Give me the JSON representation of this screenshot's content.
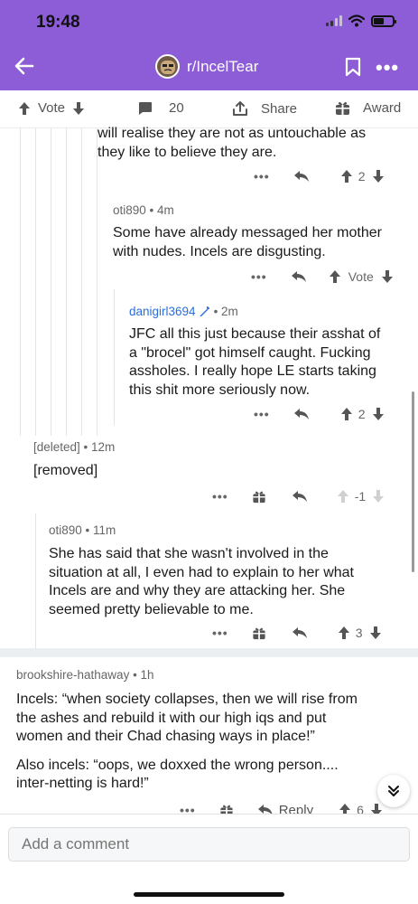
{
  "status_bar": {
    "time": "19:48"
  },
  "header": {
    "subreddit": "r/IncelTear"
  },
  "action_bar": {
    "vote": "Vote",
    "comments": "20",
    "share": "Share",
    "award": "Award"
  },
  "comments": [
    {
      "id": "c1",
      "author": "",
      "body_lines": [
        "will realise they are not as untouchable as",
        "they like to believe they are."
      ],
      "votes": "2"
    },
    {
      "id": "c2",
      "author": "oti890 • 4m",
      "body_lines": [
        "Some have already messaged her mother",
        "with nudes. Incels are disgusting."
      ],
      "votes": "Vote"
    },
    {
      "id": "c3",
      "author": "danigirl3694",
      "age": "• 2m",
      "body_lines": [
        "JFC all this just because their asshat of",
        "a \"brocel\" got himself caught. Fucking",
        "assholes. I really hope LE starts taking",
        "this shit more seriously now."
      ],
      "votes": "2"
    },
    {
      "id": "c4",
      "author": "[deleted] • 12m",
      "body_lines": [
        "[removed]"
      ],
      "votes": "-1"
    },
    {
      "id": "c5",
      "author": "oti890 • 11m",
      "body_lines": [
        "She has said that she wasn't involved in the",
        "situation at all, I even had to explain to her what",
        "Incels are and why they are attacking her. She",
        "seemed pretty believable to me."
      ],
      "votes": "3"
    },
    {
      "id": "c6",
      "author": "brookshire-hathaway • 1h",
      "body_lines": [
        "Incels: “when society collapses, then we will rise from",
        "the ashes and rebuild it with our high iqs and put",
        "women and their Chad chasing ways in place!”"
      ],
      "body_lines_2": [
        "Also incels:  “oops, we doxxed the wrong person....",
        "inter-netting is hard!”"
      ],
      "reply": "Reply",
      "votes": "6"
    }
  ],
  "comment_bar": {
    "placeholder": "Add a comment"
  },
  "colors": {
    "header": "#8c5dd6",
    "mod_badge": "#2a6fdb",
    "username_link": "#2a6fdb"
  }
}
